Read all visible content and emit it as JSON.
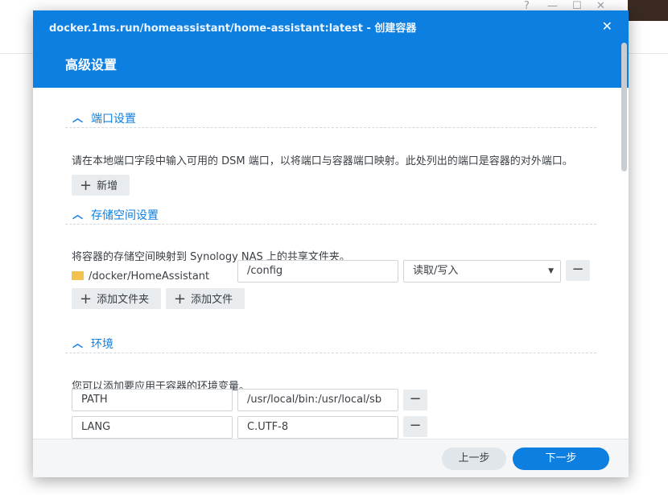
{
  "background": {
    "controls": [
      "?",
      "—",
      "☐",
      "✕"
    ]
  },
  "dialog": {
    "title": "docker.1ms.run/homeassistant/home-assistant:latest - 创建容器",
    "close": "✕",
    "subtitle": "高级设置"
  },
  "ports": {
    "title": "端口设置",
    "description": "请在本地端口字段中输入可用的 DSM 端口，以将端口与容器端口映射。此处列出的端口是容器的对外端口。",
    "add_label": "新增"
  },
  "storage": {
    "title": "存储空间设置",
    "description": "将容器的存储空间映射到 Synology NAS 上的共享文件夹。",
    "rows": [
      {
        "host_path": "/docker/HomeAssistant",
        "mount_path": "/config",
        "permission": "读取/写入"
      }
    ],
    "add_folder_label": "添加文件夹",
    "add_file_label": "添加文件"
  },
  "environment": {
    "title": "环境",
    "description": "您可以添加要应用于容器的环境变量。",
    "vars": [
      {
        "name": "PATH",
        "value": "/usr/local/bin:/usr/local/sb"
      },
      {
        "name": "LANG",
        "value": "C.UTF-8"
      }
    ]
  },
  "footer": {
    "prev_label": "上一步",
    "next_label": "下一步"
  },
  "icons": {
    "chevron": "chevron-up-icon",
    "plus": "plus-icon",
    "minus": "minus-icon",
    "folder": "folder-icon",
    "caret": "caret-down-icon"
  },
  "colors": {
    "accent": "#0d7fe0",
    "header": "#0d7fe0",
    "folder": "#f2c24f"
  }
}
